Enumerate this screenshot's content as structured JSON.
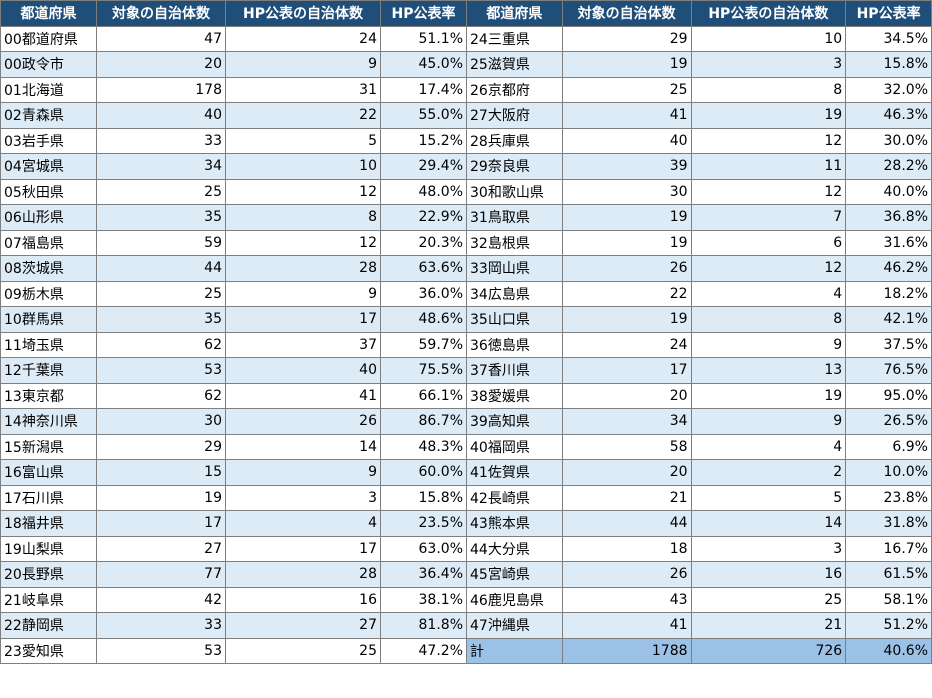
{
  "headers": [
    "都道府県",
    "対象の自治体数",
    "HP公表の自治体数",
    "HP公表率"
  ],
  "left_rows": [
    [
      "00都道府県",
      "47",
      "24",
      "51.1%"
    ],
    [
      "00政令市",
      "20",
      "9",
      "45.0%"
    ],
    [
      "01北海道",
      "178",
      "31",
      "17.4%"
    ],
    [
      "02青森県",
      "40",
      "22",
      "55.0%"
    ],
    [
      "03岩手県",
      "33",
      "5",
      "15.2%"
    ],
    [
      "04宮城県",
      "34",
      "10",
      "29.4%"
    ],
    [
      "05秋田県",
      "25",
      "12",
      "48.0%"
    ],
    [
      "06山形県",
      "35",
      "8",
      "22.9%"
    ],
    [
      "07福島県",
      "59",
      "12",
      "20.3%"
    ],
    [
      "08茨城県",
      "44",
      "28",
      "63.6%"
    ],
    [
      "09栃木県",
      "25",
      "9",
      "36.0%"
    ],
    [
      "10群馬県",
      "35",
      "17",
      "48.6%"
    ],
    [
      "11埼玉県",
      "62",
      "37",
      "59.7%"
    ],
    [
      "12千葉県",
      "53",
      "40",
      "75.5%"
    ],
    [
      "13東京都",
      "62",
      "41",
      "66.1%"
    ],
    [
      "14神奈川県",
      "30",
      "26",
      "86.7%"
    ],
    [
      "15新潟県",
      "29",
      "14",
      "48.3%"
    ],
    [
      "16富山県",
      "15",
      "9",
      "60.0%"
    ],
    [
      "17石川県",
      "19",
      "3",
      "15.8%"
    ],
    [
      "18福井県",
      "17",
      "4",
      "23.5%"
    ],
    [
      "19山梨県",
      "27",
      "17",
      "63.0%"
    ],
    [
      "20長野県",
      "77",
      "28",
      "36.4%"
    ],
    [
      "21岐阜県",
      "42",
      "16",
      "38.1%"
    ],
    [
      "22静岡県",
      "33",
      "27",
      "81.8%"
    ],
    [
      "23愛知県",
      "53",
      "25",
      "47.2%"
    ]
  ],
  "right_rows": [
    [
      "24三重県",
      "29",
      "10",
      "34.5%"
    ],
    [
      "25滋賀県",
      "19",
      "3",
      "15.8%"
    ],
    [
      "26京都府",
      "25",
      "8",
      "32.0%"
    ],
    [
      "27大阪府",
      "41",
      "19",
      "46.3%"
    ],
    [
      "28兵庫県",
      "40",
      "12",
      "30.0%"
    ],
    [
      "29奈良県",
      "39",
      "11",
      "28.2%"
    ],
    [
      "30和歌山県",
      "30",
      "12",
      "40.0%"
    ],
    [
      "31鳥取県",
      "19",
      "7",
      "36.8%"
    ],
    [
      "32島根県",
      "19",
      "6",
      "31.6%"
    ],
    [
      "33岡山県",
      "26",
      "12",
      "46.2%"
    ],
    [
      "34広島県",
      "22",
      "4",
      "18.2%"
    ],
    [
      "35山口県",
      "19",
      "8",
      "42.1%"
    ],
    [
      "36徳島県",
      "24",
      "9",
      "37.5%"
    ],
    [
      "37香川県",
      "17",
      "13",
      "76.5%"
    ],
    [
      "38愛媛県",
      "20",
      "19",
      "95.0%"
    ],
    [
      "39高知県",
      "34",
      "9",
      "26.5%"
    ],
    [
      "40福岡県",
      "58",
      "4",
      "6.9%"
    ],
    [
      "41佐賀県",
      "20",
      "2",
      "10.0%"
    ],
    [
      "42長崎県",
      "21",
      "5",
      "23.8%"
    ],
    [
      "43熊本県",
      "44",
      "14",
      "31.8%"
    ],
    [
      "44大分県",
      "18",
      "3",
      "16.7%"
    ],
    [
      "45宮崎県",
      "26",
      "16",
      "61.5%"
    ],
    [
      "46鹿児島県",
      "43",
      "25",
      "58.1%"
    ],
    [
      "47沖縄県",
      "41",
      "21",
      "51.2%"
    ]
  ],
  "total_row": [
    "計",
    "1788",
    "726",
    "40.6%"
  ]
}
